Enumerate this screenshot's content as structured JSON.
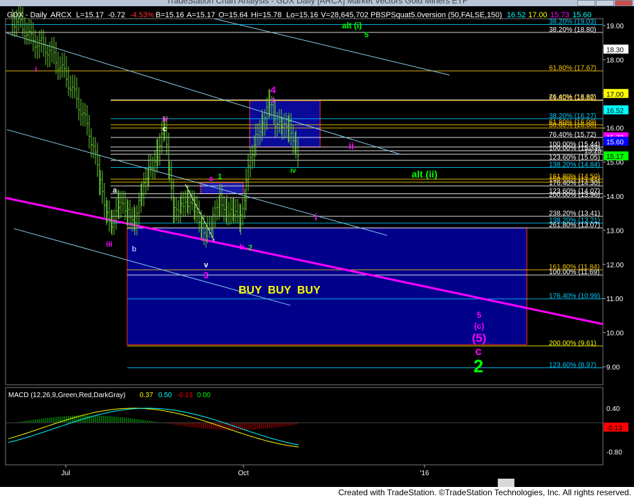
{
  "window": {
    "title": "TradeStation Chart Analysis - GDX Daily [ARCX] Market Vectors Gold Miners ETF"
  },
  "header": {
    "symbol": "GDX - Daily",
    "exchange": "ARCX",
    "last": "L=15.17",
    "change": "-0.72",
    "change_pct": "-4.53%",
    "bid": "B=15.16",
    "ask": "A=15.17",
    "open": "O=15.64",
    "high": "Hi=15.78",
    "low": "Lo=15.16",
    "volume": "V=28,645,702",
    "indicator": "PBSPSquat5.0version (50,FALSE,150)",
    "ind_v1": "16.52",
    "ind_v2": "17.00",
    "ind_v3": "15.73",
    "ind_v4": "15.60"
  },
  "footer": {
    "credit": "Created with TradeStation. ©TradeStation Technologies, Inc. All rights reserved."
  },
  "chart_data": [
    {
      "type": "candlestick",
      "symbol": "GDX",
      "interval": "Daily",
      "y_axis_ticks": [
        19.0,
        18.0,
        17.0,
        16.0,
        15.0,
        14.0,
        13.0,
        12.0,
        11.0,
        10.0,
        9.0
      ],
      "y_axis_labels": [
        "19.00",
        "18.00",
        "17.00",
        "16.00",
        "15.00",
        "14.00",
        "13.00",
        "12.00",
        "11.00",
        "10.00",
        "9.00"
      ],
      "ylim": [
        8.35,
        19.75
      ],
      "x_axis_labels": [
        "Jul",
        "Oct",
        "'16"
      ],
      "price_tags": [
        {
          "value": 18.3,
          "text": "18.30",
          "color": "#000000",
          "bg": "#ffffff"
        },
        {
          "value": 17.0,
          "text": "17.00",
          "color": "#000000",
          "bg": "#ffff00"
        },
        {
          "value": 16.52,
          "text": "16.52",
          "color": "#000000",
          "bg": "#00ffff"
        },
        {
          "value": 15.73,
          "text": "15.73",
          "color": "#ffffff",
          "bg": "#ff00ff"
        },
        {
          "value": 15.6,
          "text": "15.60",
          "color": "#ffffff",
          "bg": "#0000ff"
        },
        {
          "value": 15.17,
          "text": "15.17",
          "color": "#000000",
          "bg": "#00ff00"
        }
      ],
      "fib_levels": [
        {
          "text": "38.20% (19.03)",
          "value": 19.03,
          "color": "#00ccff"
        },
        {
          "text": "38.20% (18.80)",
          "value": 18.8,
          "color": "#ffffff"
        },
        {
          "text": "61.80% (17.67)",
          "value": 17.67,
          "color": "#ffc800"
        },
        {
          "text": "76.40% (16.82)",
          "value": 16.82,
          "color": "#ffffff"
        },
        {
          "text": "61.80% (16.80)",
          "value": 16.8,
          "color": "#ffc800"
        },
        {
          "text": "38.20% (16.27)",
          "value": 16.27,
          "color": "#00ccff"
        },
        {
          "text": "61.80% (16.09)",
          "value": 16.09,
          "color": "#ffc800"
        },
        {
          "text": "50.00% (16.00)",
          "value": 16.0,
          "color": "#ffc800"
        },
        {
          "text": "76.40% (15.72)",
          "value": 15.72,
          "color": "#ffffff"
        },
        {
          "text": "100.00% (15.44)",
          "value": 15.44,
          "color": "#ffffff"
        },
        {
          "text": "100.00% (15.33)",
          "value": 15.33,
          "color": "#ffffff"
        },
        {
          "text": "15.23",
          "value": 15.23,
          "color": "#ffffff"
        },
        {
          "text": "123.60% (15.05)",
          "value": 15.05,
          "color": "#ffffff"
        },
        {
          "text": "138.20% (14.84)",
          "value": 14.84,
          "color": "#00ccff"
        },
        {
          "text": "161.80% (14.50)",
          "value": 14.5,
          "color": "#ffc800"
        },
        {
          "text": "150.00% (14.41)",
          "value": 14.41,
          "color": "#ffc800"
        },
        {
          "text": "176.40% (14.30)",
          "value": 14.3,
          "color": "#ffffff"
        },
        {
          "text": "123.60% (14.07)",
          "value": 14.07,
          "color": "#ffffff"
        },
        {
          "text": "200.00% (13.96)",
          "value": 13.96,
          "color": "#ffffff"
        },
        {
          "text": "238.20% (13.41)",
          "value": 13.41,
          "color": "#ffffff"
        },
        {
          "text": "138.20% (13.21)",
          "value": 13.21,
          "color": "#00ccff"
        },
        {
          "text": "261.80% (13.07)",
          "value": 13.07,
          "color": "#ffffff"
        },
        {
          "text": "161.80% (11.84)",
          "value": 11.84,
          "color": "#ffc800"
        },
        {
          "text": "100.00% (11.69)",
          "value": 11.69,
          "color": "#ffffff"
        },
        {
          "text": "176.40% (10.99)",
          "value": 10.99,
          "color": "#00ccff"
        },
        {
          "text": "200.00% (9.61)",
          "value": 9.61,
          "color": "#ffff00"
        },
        {
          "text": "123.60% (8.97)",
          "value": 8.97,
          "color": "#00ccff"
        }
      ],
      "wave_labels": [
        {
          "text": "i",
          "color": "#ff00ff"
        },
        {
          "text": "iii",
          "color": "#ff00ff"
        },
        {
          "text": "b",
          "color": "#aaaaff"
        },
        {
          "text": "a",
          "color": "#ffffff"
        },
        {
          "text": "iv",
          "color": "#ff00ff"
        },
        {
          "text": "c",
          "color": "#ffffff"
        },
        {
          "text": "v",
          "color": "#ffffff"
        },
        {
          "text": "3",
          "color": "#ff00ff"
        },
        {
          "text": "a",
          "color": "#ff00ff"
        },
        {
          "text": "1",
          "color": "#00ff00"
        },
        {
          "text": "b",
          "color": "#ff00ff"
        },
        {
          "text": "2",
          "color": "#00ff00"
        },
        {
          "text": "4",
          "color": "#ff00ff"
        },
        {
          "text": "c",
          "color": "#ff00ff"
        },
        {
          "text": "iv",
          "color": "#00ff00"
        },
        {
          "text": "ii",
          "color": "#ff00ff"
        },
        {
          "text": "i",
          "color": "#ff00ff"
        },
        {
          "text": "alt (ii)",
          "color": "#00ff00"
        },
        {
          "text": "alt (i)",
          "color": "#00ff00"
        },
        {
          "text": "5",
          "color": "#00ff00"
        },
        {
          "text": "5",
          "color": "#ff00ff"
        },
        {
          "text": "(c)",
          "color": "#ff00ff"
        },
        {
          "text": "(5)",
          "color": "#ff00ff"
        },
        {
          "text": "c",
          "color": "#ff00ff"
        },
        {
          "text": "2",
          "color": "#00ff00"
        }
      ],
      "annotation": "BUY  BUY  BUY"
    },
    {
      "type": "line",
      "title": "MACD (12,26,9,Green,Red,DarkGray)",
      "values_text": [
        "0.37",
        "0.50",
        "-0.13",
        "0.00"
      ],
      "values_colors": [
        "#ffff00",
        "#00ffff",
        "#ff0000",
        "#00ff00"
      ],
      "y_axis_labels": [
        "0.40",
        "-0.80"
      ],
      "last_value_tag": "-0.13",
      "ylim": [
        -0.95,
        0.75
      ]
    }
  ],
  "colors": {
    "background": "#000000",
    "fib_box": "#00008b",
    "trendline_main": "#ff00ff",
    "channel": "#87ceeb",
    "candle_up": "#66cc33",
    "candle_down": "#66cc33"
  }
}
